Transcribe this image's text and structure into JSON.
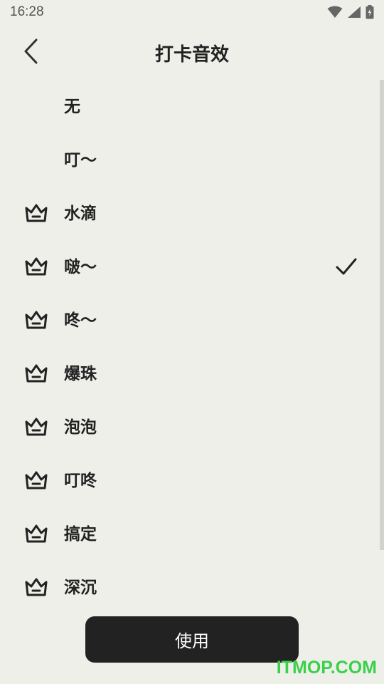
{
  "status_bar": {
    "time": "16:28",
    "icons": [
      "wifi-icon",
      "signal-icon",
      "battery-charging-icon"
    ]
  },
  "header": {
    "title": "打卡音效",
    "back_icon": "chevron-left-icon"
  },
  "sounds": [
    {
      "label": "无",
      "vip": false,
      "selected": false
    },
    {
      "label": "叮～",
      "vip": false,
      "selected": false
    },
    {
      "label": "水滴",
      "vip": true,
      "selected": false
    },
    {
      "label": "啵～",
      "vip": true,
      "selected": true
    },
    {
      "label": "咚～",
      "vip": true,
      "selected": false
    },
    {
      "label": "爆珠",
      "vip": true,
      "selected": false
    },
    {
      "label": "泡泡",
      "vip": true,
      "selected": false
    },
    {
      "label": "叮咚",
      "vip": true,
      "selected": false
    },
    {
      "label": "搞定",
      "vip": true,
      "selected": false
    },
    {
      "label": "深沉",
      "vip": true,
      "selected": false
    }
  ],
  "footer": {
    "use_label": "使用"
  },
  "watermark": "ITMOP.COM",
  "colors": {
    "background": "#efefea",
    "button": "#222222",
    "watermark": "#3ad14a"
  }
}
